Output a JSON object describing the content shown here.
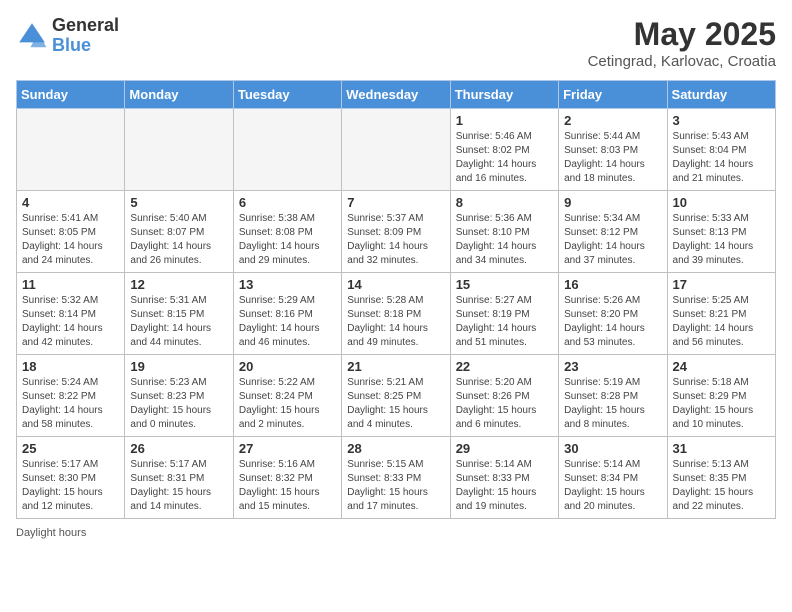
{
  "logo": {
    "general": "General",
    "blue": "Blue"
  },
  "title": "May 2025",
  "location": "Cetingrad, Karlovac, Croatia",
  "days_of_week": [
    "Sunday",
    "Monday",
    "Tuesday",
    "Wednesday",
    "Thursday",
    "Friday",
    "Saturday"
  ],
  "footer_label": "Daylight hours",
  "weeks": [
    [
      {
        "num": "",
        "info": ""
      },
      {
        "num": "",
        "info": ""
      },
      {
        "num": "",
        "info": ""
      },
      {
        "num": "",
        "info": ""
      },
      {
        "num": "1",
        "info": "Sunrise: 5:46 AM\nSunset: 8:02 PM\nDaylight: 14 hours and 16 minutes."
      },
      {
        "num": "2",
        "info": "Sunrise: 5:44 AM\nSunset: 8:03 PM\nDaylight: 14 hours and 18 minutes."
      },
      {
        "num": "3",
        "info": "Sunrise: 5:43 AM\nSunset: 8:04 PM\nDaylight: 14 hours and 21 minutes."
      }
    ],
    [
      {
        "num": "4",
        "info": "Sunrise: 5:41 AM\nSunset: 8:05 PM\nDaylight: 14 hours and 24 minutes."
      },
      {
        "num": "5",
        "info": "Sunrise: 5:40 AM\nSunset: 8:07 PM\nDaylight: 14 hours and 26 minutes."
      },
      {
        "num": "6",
        "info": "Sunrise: 5:38 AM\nSunset: 8:08 PM\nDaylight: 14 hours and 29 minutes."
      },
      {
        "num": "7",
        "info": "Sunrise: 5:37 AM\nSunset: 8:09 PM\nDaylight: 14 hours and 32 minutes."
      },
      {
        "num": "8",
        "info": "Sunrise: 5:36 AM\nSunset: 8:10 PM\nDaylight: 14 hours and 34 minutes."
      },
      {
        "num": "9",
        "info": "Sunrise: 5:34 AM\nSunset: 8:12 PM\nDaylight: 14 hours and 37 minutes."
      },
      {
        "num": "10",
        "info": "Sunrise: 5:33 AM\nSunset: 8:13 PM\nDaylight: 14 hours and 39 minutes."
      }
    ],
    [
      {
        "num": "11",
        "info": "Sunrise: 5:32 AM\nSunset: 8:14 PM\nDaylight: 14 hours and 42 minutes."
      },
      {
        "num": "12",
        "info": "Sunrise: 5:31 AM\nSunset: 8:15 PM\nDaylight: 14 hours and 44 minutes."
      },
      {
        "num": "13",
        "info": "Sunrise: 5:29 AM\nSunset: 8:16 PM\nDaylight: 14 hours and 46 minutes."
      },
      {
        "num": "14",
        "info": "Sunrise: 5:28 AM\nSunset: 8:18 PM\nDaylight: 14 hours and 49 minutes."
      },
      {
        "num": "15",
        "info": "Sunrise: 5:27 AM\nSunset: 8:19 PM\nDaylight: 14 hours and 51 minutes."
      },
      {
        "num": "16",
        "info": "Sunrise: 5:26 AM\nSunset: 8:20 PM\nDaylight: 14 hours and 53 minutes."
      },
      {
        "num": "17",
        "info": "Sunrise: 5:25 AM\nSunset: 8:21 PM\nDaylight: 14 hours and 56 minutes."
      }
    ],
    [
      {
        "num": "18",
        "info": "Sunrise: 5:24 AM\nSunset: 8:22 PM\nDaylight: 14 hours and 58 minutes."
      },
      {
        "num": "19",
        "info": "Sunrise: 5:23 AM\nSunset: 8:23 PM\nDaylight: 15 hours and 0 minutes."
      },
      {
        "num": "20",
        "info": "Sunrise: 5:22 AM\nSunset: 8:24 PM\nDaylight: 15 hours and 2 minutes."
      },
      {
        "num": "21",
        "info": "Sunrise: 5:21 AM\nSunset: 8:25 PM\nDaylight: 15 hours and 4 minutes."
      },
      {
        "num": "22",
        "info": "Sunrise: 5:20 AM\nSunset: 8:26 PM\nDaylight: 15 hours and 6 minutes."
      },
      {
        "num": "23",
        "info": "Sunrise: 5:19 AM\nSunset: 8:28 PM\nDaylight: 15 hours and 8 minutes."
      },
      {
        "num": "24",
        "info": "Sunrise: 5:18 AM\nSunset: 8:29 PM\nDaylight: 15 hours and 10 minutes."
      }
    ],
    [
      {
        "num": "25",
        "info": "Sunrise: 5:17 AM\nSunset: 8:30 PM\nDaylight: 15 hours and 12 minutes."
      },
      {
        "num": "26",
        "info": "Sunrise: 5:17 AM\nSunset: 8:31 PM\nDaylight: 15 hours and 14 minutes."
      },
      {
        "num": "27",
        "info": "Sunrise: 5:16 AM\nSunset: 8:32 PM\nDaylight: 15 hours and 15 minutes."
      },
      {
        "num": "28",
        "info": "Sunrise: 5:15 AM\nSunset: 8:33 PM\nDaylight: 15 hours and 17 minutes."
      },
      {
        "num": "29",
        "info": "Sunrise: 5:14 AM\nSunset: 8:33 PM\nDaylight: 15 hours and 19 minutes."
      },
      {
        "num": "30",
        "info": "Sunrise: 5:14 AM\nSunset: 8:34 PM\nDaylight: 15 hours and 20 minutes."
      },
      {
        "num": "31",
        "info": "Sunrise: 5:13 AM\nSunset: 8:35 PM\nDaylight: 15 hours and 22 minutes."
      }
    ]
  ]
}
